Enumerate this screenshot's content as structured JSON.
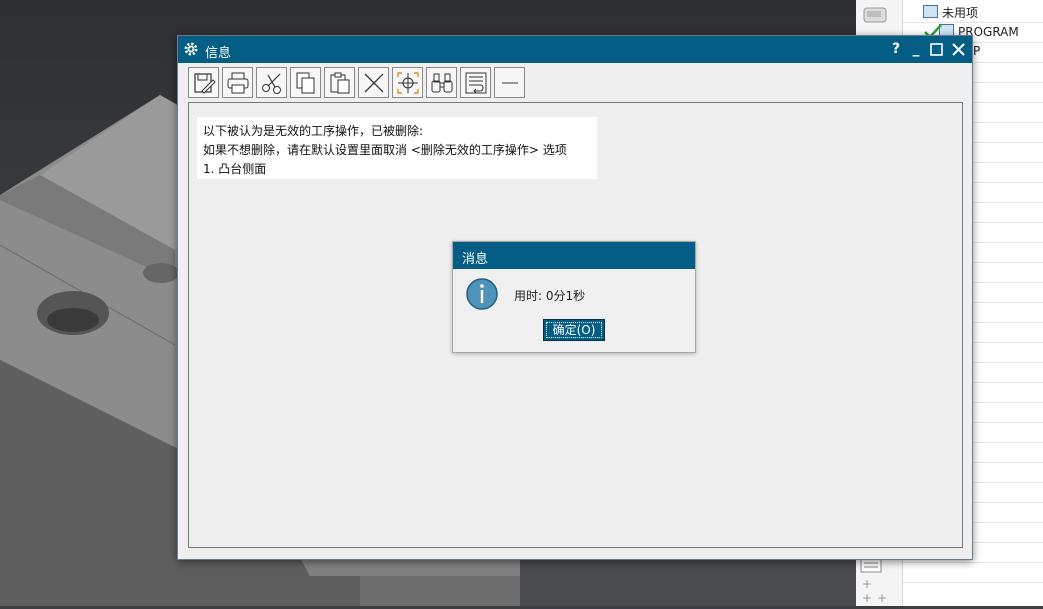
{
  "navigator": {
    "tree": [
      {
        "label": "未用项"
      },
      {
        "label": "PROGRAM"
      },
      {
        "label": "P"
      }
    ]
  },
  "info_dialog": {
    "title": "信息",
    "controls": {
      "help": "?",
      "minimize": "_"
    },
    "toolbar": [
      {
        "icon": "save-edit-icon"
      },
      {
        "icon": "print-icon"
      },
      {
        "icon": "cut-icon"
      },
      {
        "icon": "copy-icon"
      },
      {
        "icon": "paste-icon"
      },
      {
        "icon": "delete-icon"
      },
      {
        "icon": "center-target-icon"
      },
      {
        "icon": "binoculars-icon"
      },
      {
        "icon": "wrap-text-icon"
      },
      {
        "icon": "minus-icon"
      }
    ],
    "lines": [
      "以下被认为是无效的工序操作，已被删除:",
      "如果不想删除，请在默认设置里面取消 <删除无效的工序操作> 选项",
      "1. 凸台侧面"
    ]
  },
  "message_popup": {
    "title": "消息",
    "text": "用时: 0分1秒",
    "ok_label": "确定(O)"
  },
  "colors": {
    "title_bar": "#045d84",
    "dialog_bg": "#efefef",
    "check_green": "#2e9e3a"
  }
}
